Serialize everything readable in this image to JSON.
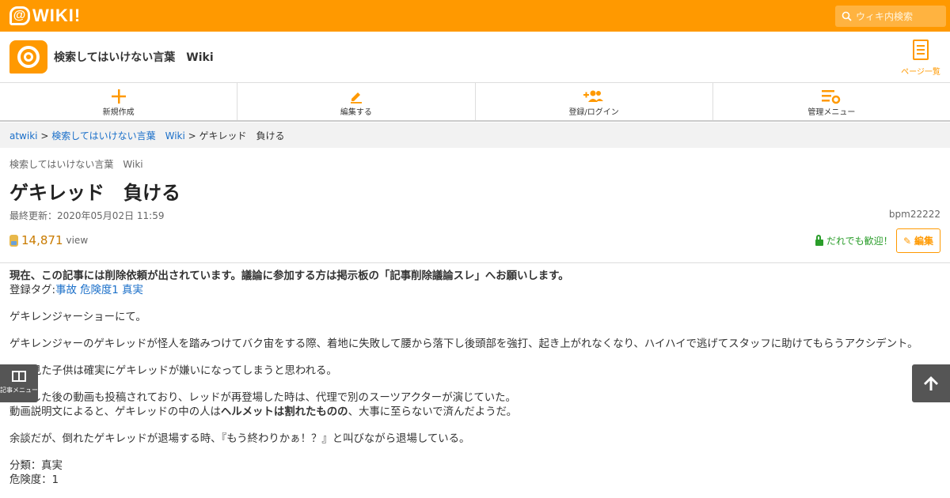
{
  "topbar": {
    "logo_text": "WIKI!",
    "logo_mark": "@",
    "search_placeholder": "ウィキ内検索"
  },
  "site": {
    "title": "検索してはいけない言葉　Wiki",
    "page_list_label": "ページ一覧"
  },
  "actions": {
    "new": "新規作成",
    "edit": "編集する",
    "login": "登録/ログイン",
    "admin": "管理メニュー"
  },
  "breadcrumb": {
    "root": "atwiki",
    "sep1": " > ",
    "wiki": "検索してはいけない言葉　Wiki",
    "sep2": " > ",
    "current": "ゲキレッド　負ける"
  },
  "page": {
    "wiki_name": "検索してはいけない言葉　Wiki",
    "title": "ゲキレッド　負ける",
    "updated": "最終更新：2020年05月02日 11:59",
    "author": "bpm22222",
    "views": "14,871",
    "views_unit": "view",
    "welcome": "だれでも歓迎！",
    "edit_label": "編集"
  },
  "content": {
    "notice": "現在、この記事には削除依頼が出されています。議論に参加する方は掲示板の「記事削除議論スレ」へお願いします。",
    "tags_label": "登録タグ:",
    "tags": [
      "事故",
      "危険度1",
      "真実"
    ],
    "p1": "ゲキレンジャーショーにて。",
    "p2": "ゲキレンジャーのゲキレッドが怪人を踏みつけてバク宙をする際、着地に失敗して腰から落下し後頭部を強打、起き上がれなくなり、ハイハイで逃げてスタッフに助けてもらうアクシデント。",
    "p3": "生で見た子供は確実にゲキレッドが嫌いになってしまうと思われる。",
    "p4a": "退場した後の動画も投稿されており、レッドが再登場した時は、代理で別のスーツアクターが演じていた。",
    "p4b_pre": "動画説明文によると、ゲキレッドの中の人は",
    "p4b_bold": "ヘルメットは割れたものの",
    "p4b_post": "、大事に至らないで済んだようだ。",
    "p5": "余談だが、倒れたゲキレッドが退場する時、『もう終わりかぁ！？』と叫びながら退場している。",
    "cat": "分類：真実",
    "danger": "危険度：1"
  },
  "floating": {
    "menu_label": "記事メニュー",
    "top_icon": "arrow-up-icon"
  },
  "colors": {
    "brand": "#ff9900",
    "link": "#1a6fc9",
    "welcome": "#2a9d2a"
  }
}
